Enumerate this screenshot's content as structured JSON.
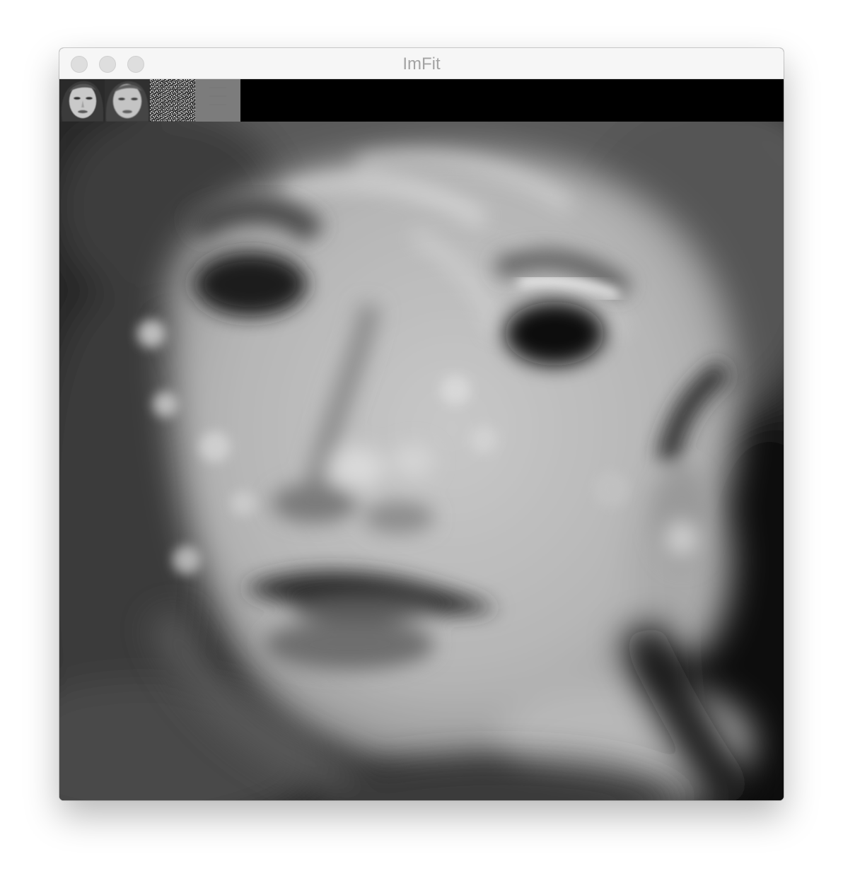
{
  "window": {
    "title": "ImFit"
  },
  "thumbnails": [
    {
      "name": "target-image-thumbnail"
    },
    {
      "name": "fitted-image-thumbnail"
    },
    {
      "name": "noise-image-thumbnail"
    },
    {
      "name": "gray-image-thumbnail"
    }
  ],
  "main_view": {
    "name": "blurred-face-fit"
  }
}
